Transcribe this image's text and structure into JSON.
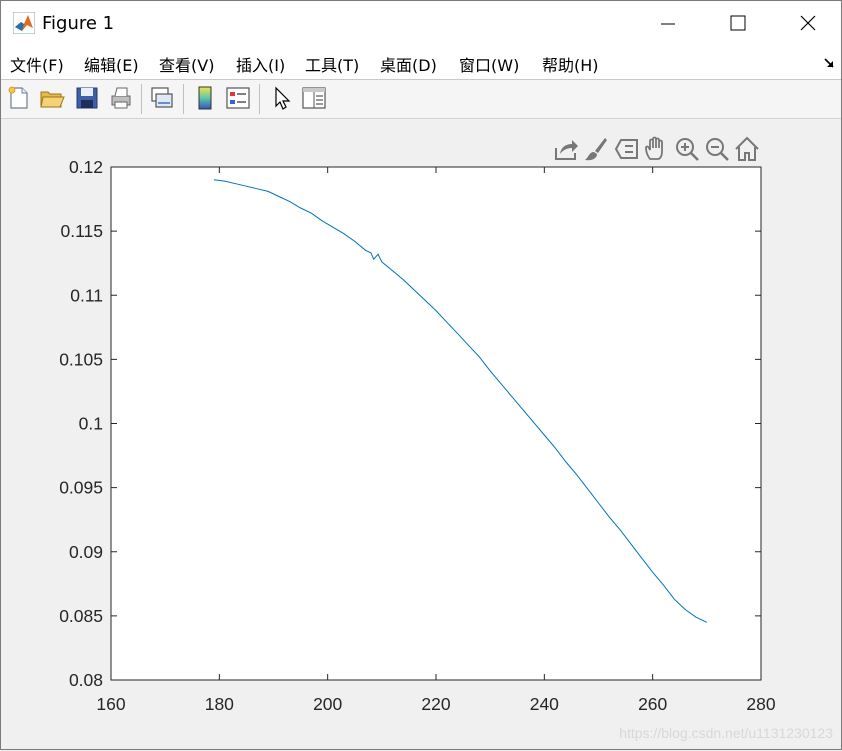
{
  "window": {
    "title": "Figure 1",
    "minimize_label": "",
    "maximize_label": "",
    "close_label": ""
  },
  "menubar": {
    "items": [
      {
        "label": "文件(F)"
      },
      {
        "label": "编辑(E)"
      },
      {
        "label": "查看(V)"
      },
      {
        "label": "插入(I)"
      },
      {
        "label": "工具(T)"
      },
      {
        "label": "桌面(D)"
      },
      {
        "label": "窗口(W)"
      },
      {
        "label": "帮助(H)"
      }
    ]
  },
  "toolbar": {
    "icons": [
      "new-figure-icon",
      "open-file-icon",
      "save-icon",
      "print-icon",
      "link-plot-icon",
      "colorbar-icon",
      "legend-icon",
      "edit-plot-arrow-icon",
      "property-inspector-icon"
    ]
  },
  "axes_toolbar": {
    "icons": [
      "export-icon",
      "brush-icon",
      "data-tips-icon",
      "pan-hand-icon",
      "zoom-in-icon",
      "zoom-out-icon",
      "home-restore-icon"
    ]
  },
  "colors": {
    "line": "#0072bd",
    "axes_bg": "#ffffff",
    "figure_bg": "#f0f0f0"
  },
  "chart_data": {
    "type": "line",
    "title": "",
    "xlabel": "",
    "ylabel": "",
    "xlim": [
      160,
      280
    ],
    "ylim": [
      0.08,
      0.12
    ],
    "xticks": [
      160,
      180,
      200,
      220,
      240,
      260,
      280
    ],
    "xtick_labels": [
      "160",
      "180",
      "200",
      "220",
      "240",
      "260",
      "280"
    ],
    "yticks": [
      0.08,
      0.085,
      0.09,
      0.095,
      0.1,
      0.105,
      0.11,
      0.115,
      0.12
    ],
    "ytick_labels": [
      "0.08",
      "0.085",
      "0.09",
      "0.095",
      "0.1",
      "0.105",
      "0.11",
      "0.115",
      "0.12"
    ],
    "grid": false,
    "legend": "none",
    "series": [
      {
        "x": [
          179,
          181,
          183,
          185,
          187,
          189,
          191,
          193,
          195,
          197,
          199,
          201,
          203,
          205,
          207,
          208,
          208.5,
          209.3,
          210,
          212,
          214,
          216,
          218,
          220,
          222,
          224,
          226,
          228,
          230,
          232,
          234,
          236,
          238,
          240,
          242,
          244,
          246,
          248,
          250,
          252,
          254,
          256,
          258,
          260,
          262,
          264,
          266,
          268,
          270
        ],
        "y": [
          0.119,
          0.1189,
          0.1187,
          0.1185,
          0.1183,
          0.1181,
          0.1177,
          0.1173,
          0.1168,
          0.1164,
          0.1158,
          0.1153,
          0.1148,
          0.1142,
          0.1135,
          0.1133,
          0.1128,
          0.1132,
          0.1126,
          0.1119,
          0.1112,
          0.1104,
          0.1096,
          0.1088,
          0.1079,
          0.107,
          0.1061,
          0.1052,
          0.1041,
          0.1031,
          0.1021,
          0.1011,
          0.1001,
          0.0991,
          0.0981,
          0.097,
          0.096,
          0.0949,
          0.0938,
          0.0927,
          0.0917,
          0.0906,
          0.0895,
          0.0884,
          0.0874,
          0.0863,
          0.0855,
          0.0849,
          0.0845
        ]
      }
    ]
  },
  "watermark": "https://blog.csdn.net/u1131230123"
}
